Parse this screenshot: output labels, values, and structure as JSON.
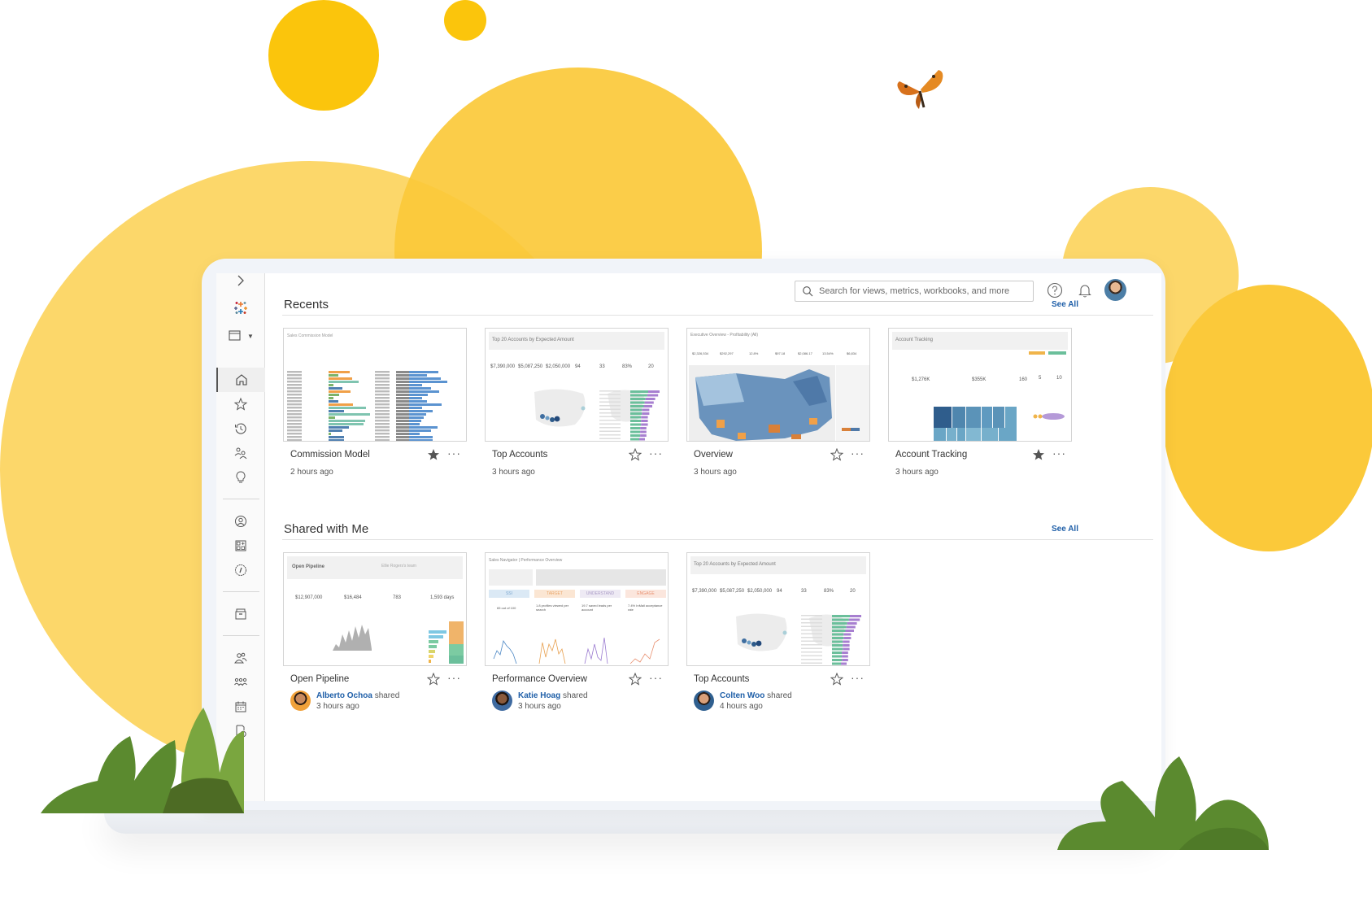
{
  "search": {
    "placeholder": "Search for views, metrics, workbooks, and more"
  },
  "topbar": {
    "help_icon": "question-circle-icon",
    "notifications_icon": "bell-icon",
    "avatar_alt": "Current user avatar"
  },
  "sidebar": {
    "items": [
      {
        "name": "expand",
        "icon": "chevron-right-icon"
      },
      {
        "name": "tableau-logo",
        "icon": "tableau-logo-icon"
      },
      {
        "name": "site-selector",
        "icon": "browser-window-icon"
      },
      {
        "name": "home",
        "icon": "home-icon",
        "active": true
      },
      {
        "name": "favorites",
        "icon": "star-icon"
      },
      {
        "name": "recents",
        "icon": "history-icon"
      },
      {
        "name": "shared-with-me",
        "icon": "shared-users-icon"
      },
      {
        "name": "recommendations",
        "icon": "lightbulb-icon"
      },
      {
        "name": "personal-space",
        "icon": "user-circle-icon"
      },
      {
        "name": "collections",
        "icon": "collection-grid-icon"
      },
      {
        "name": "explore",
        "icon": "compass-icon"
      },
      {
        "name": "external-assets",
        "icon": "archive-box-icon"
      },
      {
        "name": "users",
        "icon": "users-icon"
      },
      {
        "name": "groups",
        "icon": "groups-icon"
      },
      {
        "name": "schedules",
        "icon": "calendar-icon"
      },
      {
        "name": "jobs",
        "icon": "document-clock-icon"
      }
    ]
  },
  "recents": {
    "title": "Recents",
    "see_all": "See All",
    "cards": [
      {
        "title": "Commission Model",
        "time": "2 hours ago",
        "favorited": true,
        "thumb_title": "Sales Commission Model"
      },
      {
        "title": "Top Accounts",
        "time": "3 hours ago",
        "favorited": false,
        "thumb_title": "Top 20 Accounts by Expected Amount",
        "kpis": [
          "$7,390,000",
          "$5,087,250",
          "$2,050,000",
          "94",
          "33",
          "83%",
          "20"
        ]
      },
      {
        "title": "Overview",
        "time": "3 hours ago",
        "favorited": false,
        "thumb_title": "Executive Overview - Profitability (All)",
        "kpis": [
          "$2,326,534",
          "$292,297",
          "12.8%",
          "$97.18",
          "$2,086.17",
          "13.54%",
          "$6,834"
        ]
      },
      {
        "title": "Account Tracking",
        "time": "3 hours ago",
        "favorited": true,
        "thumb_title": "Account Tracking",
        "kpis": [
          "$1,276K",
          "$355K",
          "160",
          "5",
          "10"
        ]
      }
    ]
  },
  "shared": {
    "title": "Shared with Me",
    "see_all": "See All",
    "cards": [
      {
        "title": "Open Pipeline",
        "user": "Alberto Ochoa",
        "action": "shared",
        "time": "3 hours ago",
        "favorited": false,
        "thumb_title": "Open Pipeline",
        "thumb_subtitle": "Ellie Rogers's team",
        "kpis": [
          "$12,907,000",
          "$16,484",
          "783",
          "1,593 days"
        ]
      },
      {
        "title": "Performance Overview",
        "user": "Katie Hoag",
        "action": "shared",
        "time": "3 hours ago",
        "favorited": false,
        "thumb_title": "Sales Navigator | Performance Overview",
        "tiles": [
          "SSI",
          "TARGET",
          "UNDERSTAND",
          "ENGAGE"
        ],
        "stats": [
          "65 out of 100",
          "1.8 profiles viewed per search",
          "19.7 saved leads per account",
          "7.4% InMail acceptance rate"
        ]
      },
      {
        "title": "Top Accounts",
        "user": "Colten Woo",
        "action": "shared",
        "time": "4 hours ago",
        "favorited": false,
        "thumb_title": "Top 20 Accounts by Expected Amount",
        "kpis": [
          "$7,390,000",
          "$5,087,250",
          "$2,050,000",
          "94",
          "33",
          "83%",
          "20"
        ]
      }
    ]
  },
  "colors": {
    "accent_link": "#1f5fa8",
    "yellow": "#fbc50c",
    "yellow_light": "#fcd76a"
  }
}
